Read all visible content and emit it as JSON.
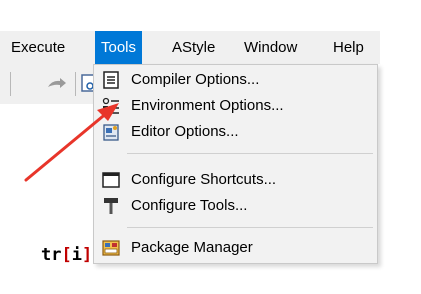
{
  "menubar": {
    "items": [
      {
        "label": "Execute"
      },
      {
        "label": "Tools"
      },
      {
        "label": "AStyle"
      },
      {
        "label": "Window"
      },
      {
        "label": "Help"
      }
    ],
    "active": "Tools"
  },
  "editor": {
    "code_text": "tr",
    "code_open_bracket": "[",
    "code_index": "i",
    "code_close": "];"
  },
  "tools_menu": {
    "items": [
      {
        "label": "Compiler Options...",
        "icon": "compiler-options-icon"
      },
      {
        "label": "Environment Options...",
        "icon": "environment-options-icon"
      },
      {
        "label": "Editor Options...",
        "icon": "editor-options-icon"
      },
      {
        "label": "Configure Shortcuts...",
        "icon": "shortcuts-icon"
      },
      {
        "label": "Configure Tools...",
        "icon": "hammer-icon"
      },
      {
        "label": "Package Manager",
        "icon": "package-manager-icon"
      }
    ]
  },
  "annotation": {
    "arrow_color": "#e8352a"
  },
  "colors": {
    "menu_highlight": "#0078d7",
    "code_red": "#c00000"
  }
}
